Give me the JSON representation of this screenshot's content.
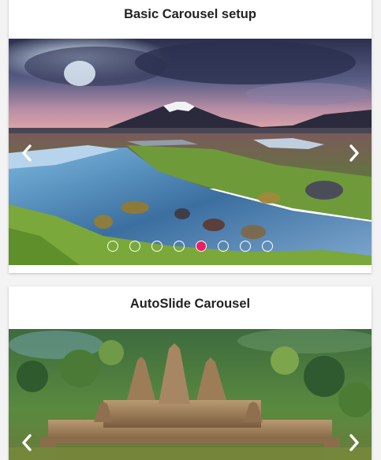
{
  "basic_carousel": {
    "title": "Basic Carousel setup",
    "slide_image": "mountain-lake-stream",
    "dot_count": 8,
    "active_dot": 4,
    "prev_icon": "chevron-left-icon",
    "next_icon": "chevron-right-icon",
    "active_dot_color": "#e91e63"
  },
  "autoslide_carousel": {
    "title": "AutoSlide Carousel",
    "slide_image": "angkor-wat-temple",
    "prev_icon": "chevron-left-icon",
    "next_icon": "chevron-right-icon"
  }
}
